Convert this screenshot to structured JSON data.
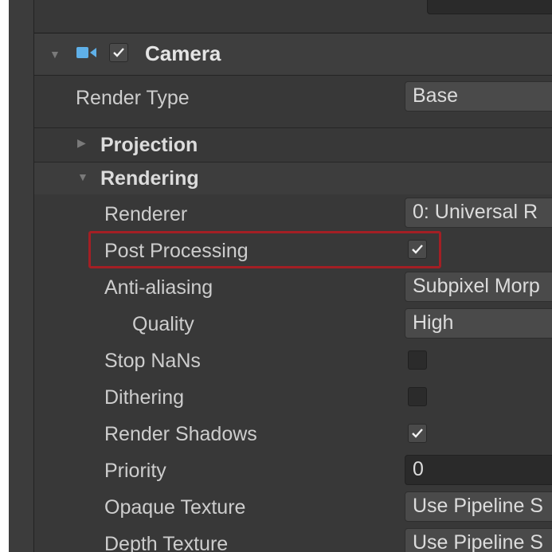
{
  "component": {
    "title": "Camera",
    "enabled": true,
    "icon": "camera-icon"
  },
  "render_type": {
    "label": "Render Type",
    "value": "Base"
  },
  "sections": {
    "projection": {
      "label": "Projection",
      "expanded": false
    },
    "rendering": {
      "label": "Rendering",
      "expanded": true
    }
  },
  "rendering": {
    "renderer": {
      "label": "Renderer",
      "value": "0: Universal R"
    },
    "post_processing": {
      "label": "Post Processing",
      "checked": true,
      "highlighted": true
    },
    "anti_aliasing": {
      "label": "Anti-aliasing",
      "value": "Subpixel Morp"
    },
    "quality": {
      "label": "Quality",
      "value": "High"
    },
    "stop_nans": {
      "label": "Stop NaNs",
      "checked": false
    },
    "dithering": {
      "label": "Dithering",
      "checked": false
    },
    "render_shadows": {
      "label": "Render Shadows",
      "checked": true
    },
    "priority": {
      "label": "Priority",
      "value": "0"
    },
    "opaque_texture": {
      "label": "Opaque Texture",
      "value": "Use Pipeline S"
    },
    "depth_texture": {
      "label": "Depth Texture",
      "value": "Use Pipeline S"
    }
  },
  "colors": {
    "panel_bg": "#383838",
    "highlight_border": "#a31f24",
    "camera_icon": "#5fb0e8",
    "text": "#cdcdcd"
  }
}
